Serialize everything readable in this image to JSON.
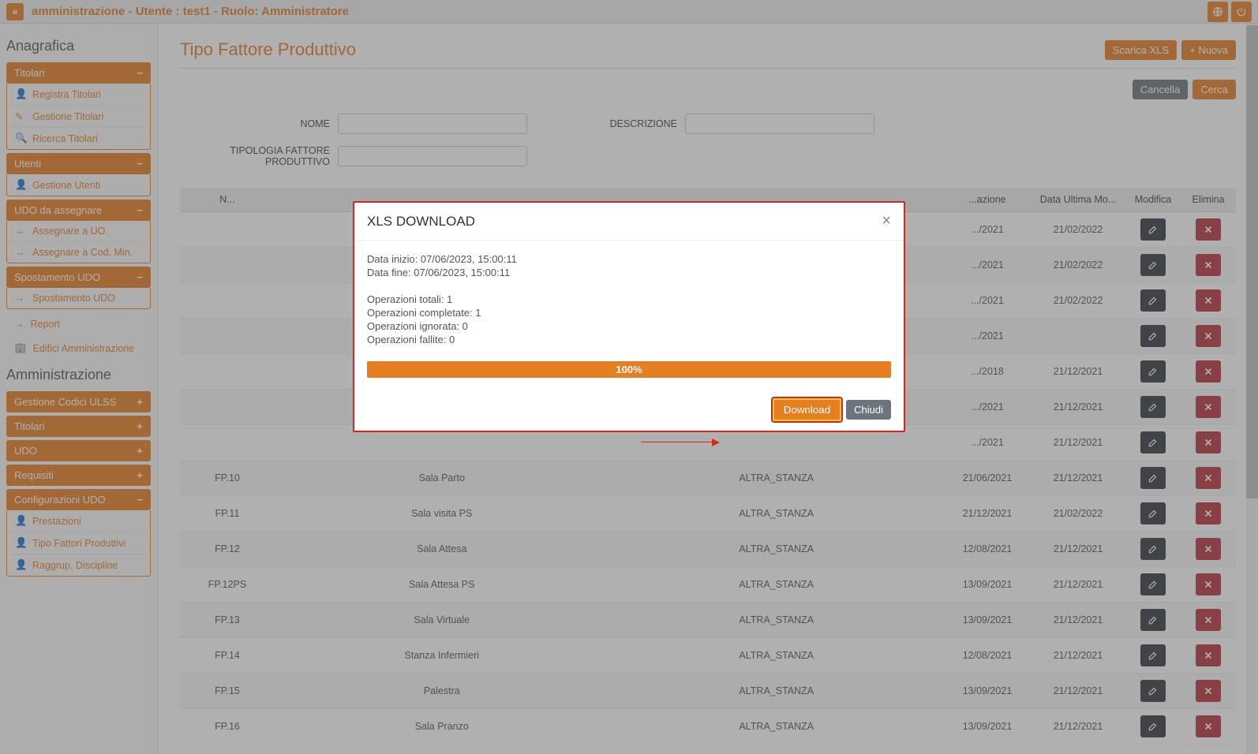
{
  "topbar": {
    "title": "amministrazione - Utente : test1 - Ruolo: Amministratore"
  },
  "sidebar": {
    "section1": "Anagrafica",
    "titolari": {
      "header": "Titolari",
      "items": [
        "Registra Titolari",
        "Gestione Titolari",
        "Ricerca Titolari"
      ]
    },
    "utenti": {
      "header": "Utenti",
      "items": [
        "Gestione Utenti"
      ]
    },
    "udo_assegnare": {
      "header": "UDO da assegnare",
      "items": [
        "Assegnare a UO",
        "Assegnare a Cod. Min."
      ]
    },
    "spostamento": {
      "header": "Spostamento UDO",
      "items": [
        "Spostamento UDO"
      ]
    },
    "links": [
      "Report",
      "Edifici Amministrazione"
    ],
    "section2": "Amministrazione",
    "collapsed": [
      "Gestione Codici ULSS",
      "Titolari",
      "UDO",
      "Requisiti"
    ],
    "config": {
      "header": "Configurazioni UDO",
      "items": [
        "Prestazioni",
        "Tipo Fattori Produttivi",
        "Raggrup. Discipline"
      ]
    }
  },
  "main": {
    "title": "Tipo Fattore Produttivo",
    "buttons": {
      "xls": "Scarica XLS",
      "new": "Nuova",
      "clear": "Cancella",
      "search": "Cerca"
    },
    "labels": {
      "nome": "NOME",
      "descrizione": "DESCRIZIONE",
      "tipologia": "TIPOLOGIA FATTORE PRODUTTIVO"
    },
    "columns": [
      "N...",
      "",
      "",
      "...azione",
      "Data Ultima Mo...",
      "Modifica",
      "Elimina"
    ],
    "rows": [
      {
        "c0": "",
        "c1": "",
        "c2": "",
        "c3": ".../2021",
        "c4": "21/02/2022"
      },
      {
        "c0": "",
        "c1": "",
        "c2": "",
        "c3": ".../2021",
        "c4": "21/02/2022"
      },
      {
        "c0": "",
        "c1": "",
        "c2": "",
        "c3": ".../2021",
        "c4": "21/02/2022"
      },
      {
        "c0": "",
        "c1": "",
        "c2": "",
        "c3": ".../2021",
        "c4": ""
      },
      {
        "c0": "",
        "c1": "",
        "c2": "",
        "c3": ".../2018",
        "c4": "21/12/2021"
      },
      {
        "c0": "",
        "c1": "",
        "c2": "",
        "c3": ".../2021",
        "c4": "21/12/2021"
      },
      {
        "c0": "",
        "c1": "",
        "c2": "",
        "c3": ".../2021",
        "c4": "21/12/2021"
      },
      {
        "c0": "FP.10",
        "c1": "Sala Parto",
        "c2": "ALTRA_STANZA",
        "c3": "21/06/2021",
        "c4": "21/12/2021"
      },
      {
        "c0": "FP.11",
        "c1": "Sala visita PS",
        "c2": "ALTRA_STANZA",
        "c3": "21/12/2021",
        "c4": "21/02/2022"
      },
      {
        "c0": "FP.12",
        "c1": "Sala Attesa",
        "c2": "ALTRA_STANZA",
        "c3": "12/08/2021",
        "c4": "21/12/2021"
      },
      {
        "c0": "FP.12PS",
        "c1": "Sala Attesa PS",
        "c2": "ALTRA_STANZA",
        "c3": "13/09/2021",
        "c4": "21/12/2021"
      },
      {
        "c0": "FP.13",
        "c1": "Sala Virtuale",
        "c2": "ALTRA_STANZA",
        "c3": "13/09/2021",
        "c4": "21/12/2021"
      },
      {
        "c0": "FP.14",
        "c1": "Stanza Infermieri",
        "c2": "ALTRA_STANZA",
        "c3": "12/08/2021",
        "c4": "21/12/2021"
      },
      {
        "c0": "FP.15",
        "c1": "Palestra",
        "c2": "ALTRA_STANZA",
        "c3": "13/09/2021",
        "c4": "21/12/2021"
      },
      {
        "c0": "FP.16",
        "c1": "Sala Pranzo",
        "c2": "ALTRA_STANZA",
        "c3": "13/09/2021",
        "c4": "21/12/2021"
      }
    ]
  },
  "modal": {
    "title": "XLS DOWNLOAD",
    "start": "Data inizio: 07/06/2023, 15:00:11",
    "end": "Data fine: 07/06/2023, 15:00:11",
    "tot": "Operazioni totali: 1",
    "comp": "Operazioni completate: 1",
    "ign": "Operazioni ignorata: 0",
    "fail": "Operazioni fallite: 0",
    "progress": "100%",
    "download": "Download",
    "close": "Chiudi"
  }
}
